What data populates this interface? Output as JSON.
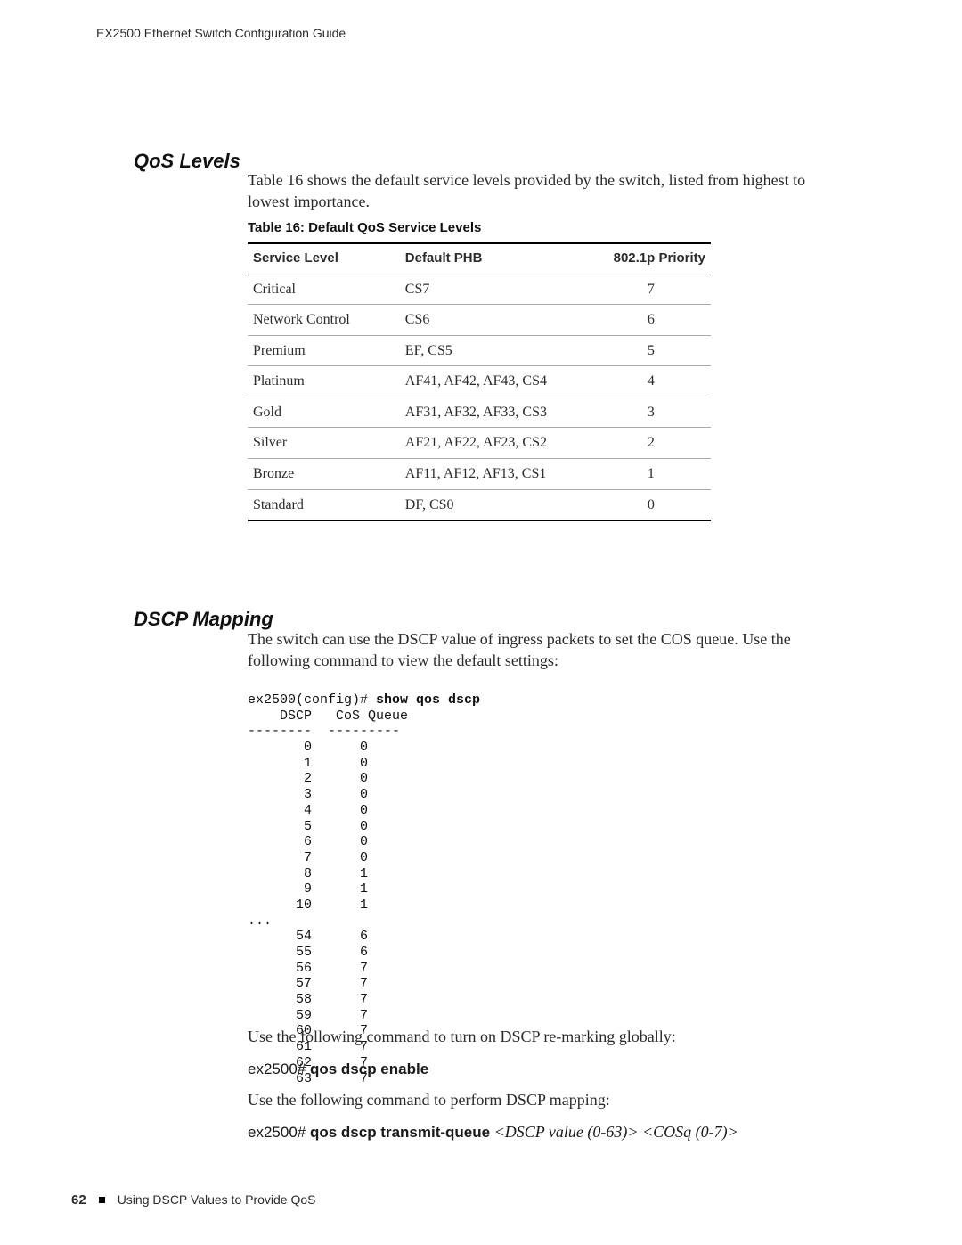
{
  "header": {
    "running": "EX2500 Ethernet Switch Configuration Guide"
  },
  "sections": {
    "qos": {
      "heading": "QoS Levels",
      "intro": "Table 16 shows the default service levels provided by the switch, listed from highest to lowest importance."
    },
    "dscp": {
      "heading": "DSCP Mapping",
      "intro": "The switch can use the DSCP value of ingress packets to set the COS queue. Use the following command to view the default settings:",
      "after_cli_1": "Use the following command to turn on DSCP re-marking globally:",
      "after_cli_2": "Use the following command to perform DSCP mapping:"
    }
  },
  "table": {
    "caption": "Table 16:  Default QoS Service Levels",
    "headers": {
      "level": "Service Level",
      "phb": "Default PHB",
      "priority": "802.1p Priority"
    },
    "rows": [
      {
        "level": "Critical",
        "phb": "CS7",
        "priority": "7"
      },
      {
        "level": "Network Control",
        "phb": "CS6",
        "priority": "6"
      },
      {
        "level": "Premium",
        "phb": "EF, CS5",
        "priority": "5"
      },
      {
        "level": "Platinum",
        "phb": "AF41, AF42, AF43, CS4",
        "priority": "4"
      },
      {
        "level": "Gold",
        "phb": "AF31, AF32, AF33, CS3",
        "priority": "3"
      },
      {
        "level": "Silver",
        "phb": "AF21, AF22, AF23, CS2",
        "priority": "2"
      },
      {
        "level": "Bronze",
        "phb": "AF11, AF12, AF13, CS1",
        "priority": "1"
      },
      {
        "level": "Standard",
        "phb": "DF, CS0",
        "priority": "0"
      }
    ]
  },
  "cli": {
    "prompt": "ex2500(config)# ",
    "command": "show qos dscp",
    "header_line": "    DSCP   CoS Queue",
    "divider_line": "--------  ---------",
    "rows_top": [
      {
        "dscp": "0",
        "cos": "0"
      },
      {
        "dscp": "1",
        "cos": "0"
      },
      {
        "dscp": "2",
        "cos": "0"
      },
      {
        "dscp": "3",
        "cos": "0"
      },
      {
        "dscp": "4",
        "cos": "0"
      },
      {
        "dscp": "5",
        "cos": "0"
      },
      {
        "dscp": "6",
        "cos": "0"
      },
      {
        "dscp": "7",
        "cos": "0"
      },
      {
        "dscp": "8",
        "cos": "1"
      },
      {
        "dscp": "9",
        "cos": "1"
      },
      {
        "dscp": "10",
        "cos": "1"
      }
    ],
    "ellipsis": "...",
    "rows_bottom": [
      {
        "dscp": "54",
        "cos": "6"
      },
      {
        "dscp": "55",
        "cos": "6"
      },
      {
        "dscp": "56",
        "cos": "7"
      },
      {
        "dscp": "57",
        "cos": "7"
      },
      {
        "dscp": "58",
        "cos": "7"
      },
      {
        "dscp": "59",
        "cos": "7"
      },
      {
        "dscp": "60",
        "cos": "7"
      },
      {
        "dscp": "61",
        "cos": "7"
      },
      {
        "dscp": "62",
        "cos": "7"
      },
      {
        "dscp": "63",
        "cos": "7"
      }
    ]
  },
  "commands": {
    "c1": {
      "prompt": "ex2500# ",
      "bold": "qos dscp enable",
      "tail": ""
    },
    "c2": {
      "prompt": "ex2500# ",
      "bold": "qos dscp transmit-queue",
      "tail": " <DSCP value (0-63)> <COSq (0-7)>"
    }
  },
  "footer": {
    "page_number": "62",
    "text": "Using DSCP Values to Provide QoS"
  }
}
